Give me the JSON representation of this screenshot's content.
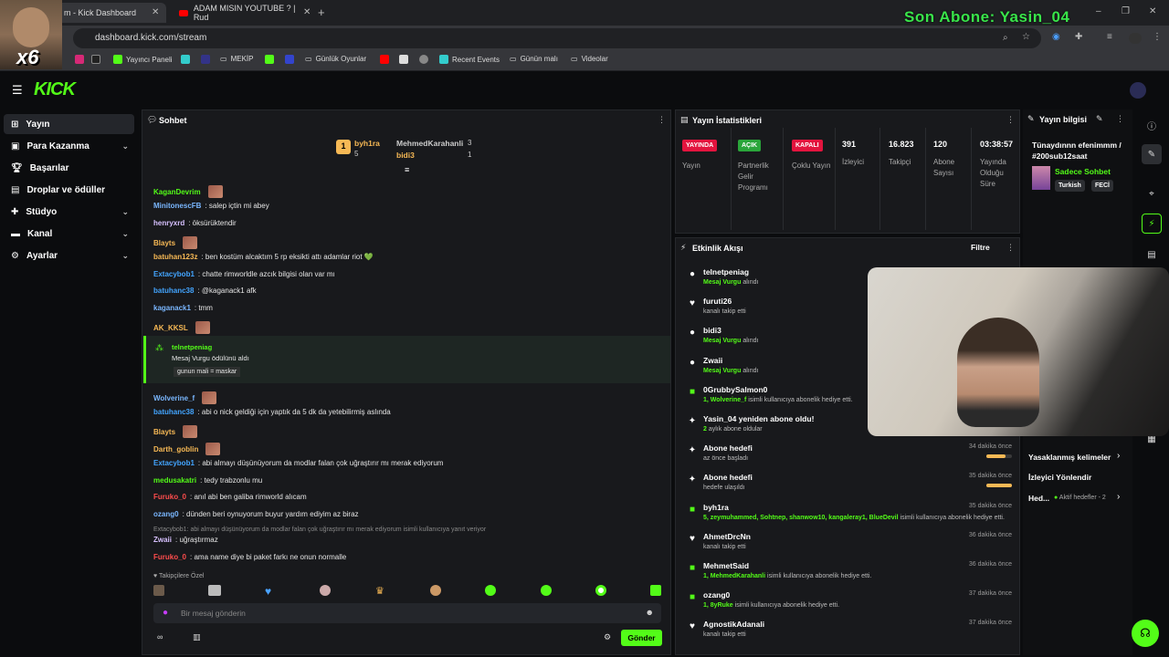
{
  "browser": {
    "tabs": [
      {
        "label": "m - Kick Dashboard"
      },
      {
        "label": "ADAM MISIN YOUTUBE ? | Rud"
      }
    ],
    "url": "dashboard.kick.com/stream",
    "bookmarks": [
      "Yayıncı Paneli",
      "MEKİP",
      "Günlük Oyunlar",
      "Recent Events",
      "Günün malı",
      "Videolar"
    ]
  },
  "overlay": {
    "last_sub": "Son Abone: Yasin_04",
    "multiplier": "x6"
  },
  "sidebar": {
    "items": [
      {
        "label": "Yayın"
      },
      {
        "label": "Para Kazanma"
      },
      {
        "label": "Başarılar"
      },
      {
        "label": "Droplar ve ödüller"
      },
      {
        "label": "Stüdyo"
      },
      {
        "label": "Kanal"
      },
      {
        "label": "Ayarlar"
      }
    ]
  },
  "chat": {
    "title": "Sohbet",
    "leaderboard": {
      "first": "byh1ra",
      "first_count": "5",
      "second": "MehmedKarahanli",
      "second_count": "3",
      "third": "bidi3",
      "third_count": "1",
      "rank": "1"
    },
    "messages": [
      {
        "user": "KaganDevrim",
        "text": "",
        "color": "#53fc18"
      },
      {
        "user": "MinitonescFB",
        "text": ": salep içtin mi abey",
        "color": "#7ab7ff"
      },
      {
        "user": "henryxrd",
        "text": ": öksürüktendir",
        "color": "#d7c1ff"
      },
      {
        "user": "Blayts",
        "text": "",
        "color": "#f7b955"
      },
      {
        "user": "batuhan123z",
        "text": ": ben kostüm alcaktım 5 rp eksikti attı adamlar riot 💚",
        "color": "#f7b955"
      },
      {
        "user": "Extacybob1",
        "text": ": chatte rimworldle azcık bilgisi olan var mı",
        "color": "#43a5ff"
      },
      {
        "user": "batuhanc38",
        "text": ": @kaganack1 afk",
        "color": "#43a5ff"
      },
      {
        "user": "kaganack1",
        "text": ": tmm",
        "color": "#7ab7ff"
      },
      {
        "user": "AK_KKSL",
        "text": "",
        "color": "#f7b955"
      },
      {
        "user": "Wolverine_f",
        "text": "",
        "color": "#7ab7ff"
      },
      {
        "user": "batuhanc38",
        "text": ": abi o nick geldiği için yaptık da 5 dk da yetebilirmiş aslında",
        "color": "#43a5ff"
      },
      {
        "user": "Blayts",
        "text": "",
        "color": "#f7b955"
      },
      {
        "user": "Darth_goblin",
        "text": "",
        "color": "#f7b955"
      },
      {
        "user": "Extacybob1",
        "text": ": abi almayı düşünüyorum da modlar falan çok uğraştırır mı merak ediyorum",
        "color": "#43a5ff"
      },
      {
        "user": "medusakatri",
        "text": ": tedy trabzonlu mu",
        "color": "#53fc18"
      },
      {
        "user": "Furuko_0",
        "text": ": anıl abi ben galiba rimworld alıcam",
        "color": "#ff4d4d"
      },
      {
        "user": "ozang0",
        "text": ": dünden beri oynuyorum buyur yardım ediyim az biraz",
        "color": "#7ab7ff"
      },
      {
        "user": "Zwaii",
        "text": ": uğraştırmaz",
        "color": "#d7c1ff"
      },
      {
        "user": "Furuko_0",
        "text": ": ama name diye bi paket farkı ne onun normalle",
        "color": "#ff4d4d"
      }
    ],
    "highlight": {
      "user": "telnetpeniag",
      "line1": "Mesaj Vurgu ödülünü aldı",
      "line2": "gunun mali = maskar"
    },
    "reply_preview": "Extacybob1: abi almayı düşünüyorum da modlar falan çok uğraştırır mı merak ediyorum isimli kullanıcıya yanıt veriyor",
    "followers_only": "Takipçilere Özel",
    "input_placeholder": "Bir mesaj gönderin",
    "send_label": "Gönder"
  },
  "stats": {
    "title": "Yayın İstatistikleri",
    "badges": [
      {
        "badge": "YAYINDA",
        "label": "Yayın",
        "color": "#e3143e"
      },
      {
        "badge": "AÇIK",
        "label": "Partnerlik Gelir Programı",
        "color": "#2aa53a"
      },
      {
        "badge": "KAPALI",
        "label": "Çoklu Yayın",
        "color": "#e3143e"
      }
    ],
    "numbers": [
      {
        "value": "391",
        "label": "İzleyici"
      },
      {
        "value": "16.823",
        "label": "Takipçi"
      },
      {
        "value": "120",
        "label": "Abone Sayısı"
      },
      {
        "value": "03:38:57",
        "label": "Yayında Olduğu Süre"
      }
    ]
  },
  "events": {
    "title": "Etkinlik Akışı",
    "filter_label": "Filtre",
    "items": [
      {
        "icon": "●",
        "name": "telnetpeniag",
        "desc_b": "Mesaj Vurgu",
        "desc": " alındı",
        "time": ""
      },
      {
        "icon": "♥",
        "name": "furuti26",
        "desc_b": "",
        "desc": "kanalı takip etti",
        "time": ""
      },
      {
        "icon": "●",
        "name": "bidi3",
        "desc_b": "Mesaj Vurgu",
        "desc": " alındı",
        "time": ""
      },
      {
        "icon": "●",
        "name": "Zwaii",
        "desc_b": "Mesaj Vurgu",
        "desc": " alındı",
        "time": ""
      },
      {
        "icon": "■",
        "name": "0GrubbySalmon0",
        "desc_b": "1, Wolverine_f",
        "desc": " isimli kullanıcıya abonelik hediye etti.",
        "time": ""
      },
      {
        "icon": "✦",
        "name": "Yasin_04 yeniden abone oldu!",
        "desc_b": "2",
        "desc": " aylık abone oldular",
        "time": ""
      },
      {
        "icon": "✦",
        "name": "Abone hedefi",
        "desc_b": "",
        "desc": "az önce başladı",
        "time": "34 dakika önce",
        "bar": 0.75
      },
      {
        "icon": "✦",
        "name": "Abone hedefi",
        "desc_b": "",
        "desc": "hedefe ulaşıldı",
        "time": "35 dakika önce",
        "bar": 1.0
      },
      {
        "icon": "■",
        "name": "byh1ra",
        "desc_b": "5, zeymuhammed, Sohtnep, shanwow10, kangaleray1, BlueDevil",
        "desc": " isimli kullanıcıya abonelik hediye etti.",
        "time": "35 dakika önce"
      },
      {
        "icon": "♥",
        "name": "AhmetDrcNn",
        "desc_b": "",
        "desc": "kanalı takip etti",
        "time": "36 dakika önce"
      },
      {
        "icon": "■",
        "name": "MehmetSaid",
        "desc_b": "1, MehmedKarahanli",
        "desc": " isimli kullanıcıya abonelik hediye etti.",
        "time": "36 dakika önce"
      },
      {
        "icon": "■",
        "name": "ozang0",
        "desc_b": "1, 8yRuke",
        "desc": " isimli kullanıcıya abonelik hediye etti.",
        "time": "37 dakika önce"
      },
      {
        "icon": "♥",
        "name": "AgnostikAdanali",
        "desc_b": "",
        "desc": "kanalı takip etti",
        "time": "37 dakika önce"
      }
    ]
  },
  "info": {
    "title": "Yayın bilgisi",
    "stream_title": "Tünaydınnn efenimmm / #200sub12saat",
    "category": "Sadece Sohbet",
    "tags": [
      "Turkish",
      "FECİ"
    ],
    "links": [
      {
        "label": "Yasaklanmış kelimeler"
      },
      {
        "label": "İzleyici Yönlendir"
      },
      {
        "label": "Hed..."
      }
    ],
    "active_goals": "Aktif hedefler - 2"
  },
  "colors": {
    "accent": "#53fc18",
    "bg": "#0b0c0e",
    "panel": "#18191c"
  }
}
